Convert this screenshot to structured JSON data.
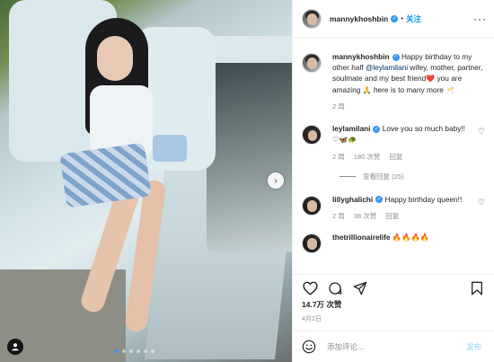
{
  "post": {
    "author": "mannykhoshbin",
    "follow_label": "关注",
    "caption_prefix": "Happy birthday to my other half ",
    "caption_mention": "@leylamilani",
    "caption_suffix_1": " wifey, mother, partner, soulmate and my best friend",
    "caption_emoji_1": "❤️",
    "caption_suffix_2": " you are amazing ",
    "caption_emoji_2": "🙏",
    "caption_suffix_3": " here is to many more ",
    "caption_emoji_3": "🥂",
    "caption_time": "2 周"
  },
  "comments": [
    {
      "user": "leylamilani",
      "text": " Love you so much baby!! ",
      "emojis": "♡🦋🐢",
      "time": "2 周",
      "likes": "180 次赞",
      "reply_label": "回复",
      "view_replies": "查看回复 (25)"
    },
    {
      "user": "lillyghalichi",
      "text": " Happy birthday queen!!",
      "time": "2 周",
      "likes": "38 次赞",
      "reply_label": "回复"
    },
    {
      "user": "thetrillionairelife",
      "text": " 🔥🔥🔥🔥"
    }
  ],
  "footer": {
    "likes": "14.7万 次赞",
    "date": "4月2日",
    "comment_placeholder": "添加评论...",
    "post_label": "发布"
  },
  "icons": {
    "like": "heart-icon",
    "comment": "comment-icon",
    "share": "share-icon",
    "save": "bookmark-icon",
    "emoji": "smile-icon",
    "next": "chevron-right-icon",
    "tag": "user-tag-icon",
    "more": "more-icon"
  },
  "carousel": {
    "count": 6,
    "active": 0
  },
  "colors": {
    "accent": "#0095f6",
    "verified": "#3897f0",
    "muted": "#8e8e8e",
    "post_disabled": "#b2dffc"
  }
}
